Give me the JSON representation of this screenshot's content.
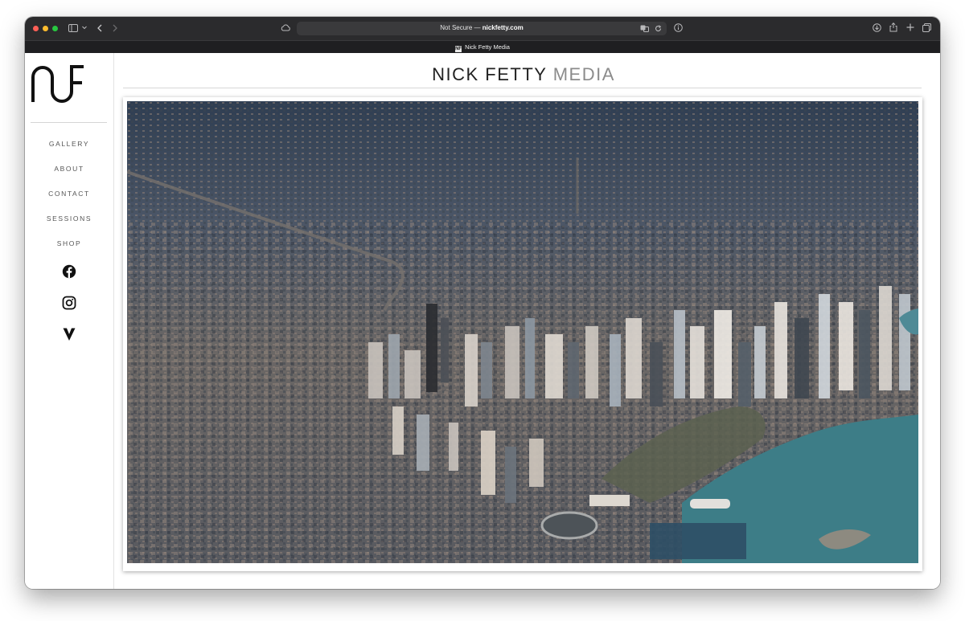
{
  "browser": {
    "address_prefix": "Not Secure —",
    "address_domain": "nickfetty.com",
    "tab_title": "Nick Fetty Media",
    "favicon_text": "NF"
  },
  "sidebar": {
    "logo_alt": "NF",
    "nav": [
      {
        "label": "GALLERY"
      },
      {
        "label": "ABOUT"
      },
      {
        "label": "CONTACT"
      },
      {
        "label": "SESSIONS"
      },
      {
        "label": "SHOP"
      }
    ],
    "social": [
      "facebook-icon",
      "instagram-icon",
      "vsco-icon"
    ]
  },
  "header": {
    "title_main": "NICK FETTY",
    "title_accent": "MEDIA"
  },
  "photo": {
    "subject": "aerial-city-photo"
  },
  "colors": {
    "toolbar": "#2b2b2d",
    "title_accent": "#8b8b8b",
    "water": "#3d7d87"
  }
}
